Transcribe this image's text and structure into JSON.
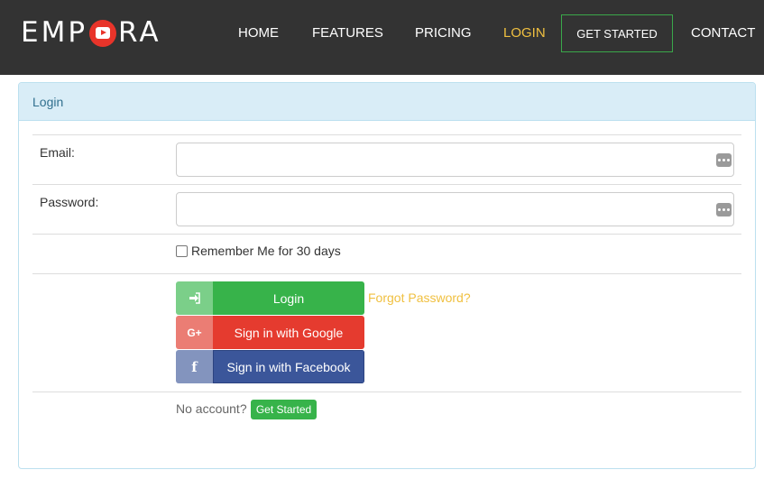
{
  "brand": {
    "logo_text_left": "EMP",
    "logo_text_right": "RA",
    "logo_color": "#e8342a"
  },
  "nav": {
    "home": "HOME",
    "features": "FEATURES",
    "pricing": "PRICING",
    "login": "LOGIN",
    "get_started": "GET STARTED",
    "contact": "CONTACT",
    "active_color": "#f0c040"
  },
  "panel": {
    "title": "Login"
  },
  "form": {
    "email_label": "Email:",
    "email_value": "",
    "email_icon": "more-dots-icon",
    "password_label": "Password:",
    "password_value": "",
    "password_icon": "more-dots-icon",
    "remember_label": "Remember Me for 30 days",
    "remember_checked": false
  },
  "buttons": {
    "login_label": "Login",
    "login_icon": "sign-in-icon",
    "google_label": "Sign in with Google",
    "google_icon": "G+",
    "facebook_label": "Sign in with Facebook",
    "facebook_icon": "f",
    "forgot_label": "Forgot Password?"
  },
  "footer": {
    "no_account_text": "No account?",
    "get_started_label": "Get Started"
  },
  "colors": {
    "navbar_bg": "#333333",
    "panel_heading_bg": "#d9edf7",
    "login_green": "#37b34a",
    "google_red": "#e53b2f",
    "facebook_blue": "#3b569a",
    "forgot_yellow": "#f0c040"
  }
}
